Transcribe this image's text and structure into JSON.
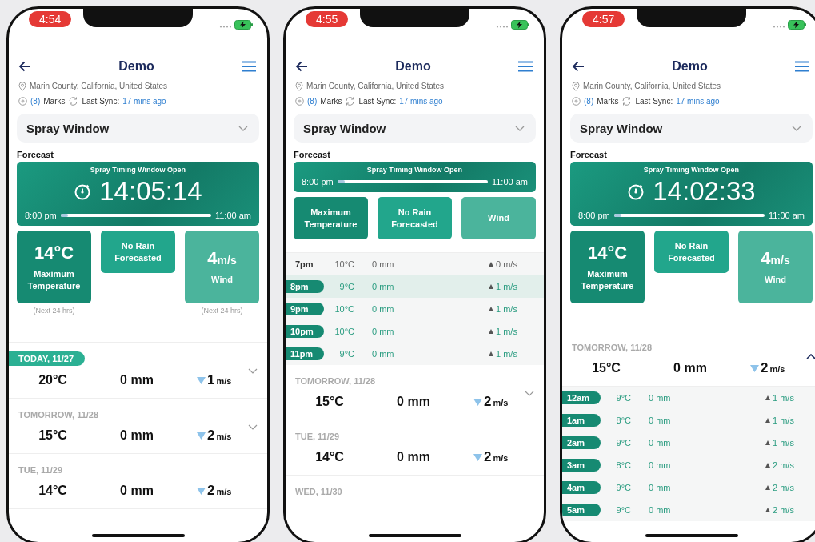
{
  "phones": [
    {
      "status_time": "4:54",
      "title": "Demo",
      "location": "Marin County, California, United States",
      "marks_count": "(8)",
      "marks_label": "Marks",
      "sync_label": "Last Sync:",
      "sync_value": "17 mins ago",
      "dropdown": "Spray Window",
      "section": "Forecast",
      "window": {
        "heading": "Spray Timing Window Open",
        "countdown": "14:05:14",
        "start": "8:00 pm",
        "end": "11:00 am",
        "level": 0.05
      },
      "tiles": [
        {
          "value": "14°C",
          "label": "Maximum Temperature",
          "note": "(Next 24 hrs)"
        },
        {
          "label": "No Rain Forecasted"
        },
        {
          "value": "4",
          "unit": "m/s",
          "label": "Wind",
          "note": "(Next 24 hrs)"
        }
      ],
      "list": [
        {
          "kind": "day",
          "date": "TODAY, 11/27",
          "selected": true,
          "expanded": false,
          "temp": "20°C",
          "rain": "0 mm",
          "wind": "1",
          "unit": "m/s"
        },
        {
          "kind": "day",
          "date": "TOMORROW, 11/28",
          "selected": false,
          "expanded": false,
          "temp": "15°C",
          "rain": "0 mm",
          "wind": "2",
          "unit": "m/s"
        },
        {
          "kind": "day",
          "date": "TUE, 11/29",
          "selected": false,
          "temp": "14°C",
          "rain": "0 mm",
          "wind": "2",
          "unit": "m/s"
        }
      ]
    },
    {
      "status_time": "4:55",
      "title": "Demo",
      "location": "Marin County, California, United States",
      "marks_count": "(8)",
      "marks_label": "Marks",
      "sync_label": "Last Sync:",
      "sync_value": "17 mins ago",
      "dropdown": "Spray Window",
      "section": "Forecast",
      "window": {
        "heading": "Spray Timing Window Open",
        "start": "8:00 pm",
        "end": "11:00 am",
        "level": 0.05
      },
      "tiles": [
        {
          "label": "Maximum Temperature"
        },
        {
          "label": "No Rain Forecasted"
        },
        {
          "label": "Wind"
        }
      ],
      "list": [
        {
          "kind": "hour",
          "time": "7pm",
          "badge": false,
          "highlighted": false,
          "temp": "10°C",
          "rain": "0 mm",
          "wind": "0 m/s"
        },
        {
          "kind": "hour",
          "time": "8pm",
          "badge": true,
          "highlighted": true,
          "temp": "9°C",
          "rain": "0 mm",
          "wind": "1 m/s"
        },
        {
          "kind": "hour",
          "time": "9pm",
          "badge": true,
          "highlighted": false,
          "temp": "10°C",
          "rain": "0 mm",
          "wind": "1 m/s"
        },
        {
          "kind": "hour",
          "time": "10pm",
          "badge": true,
          "highlighted": false,
          "temp": "10°C",
          "rain": "0 mm",
          "wind": "1 m/s"
        },
        {
          "kind": "hour",
          "time": "11pm",
          "badge": true,
          "highlighted": false,
          "temp": "9°C",
          "rain": "0 mm",
          "wind": "1 m/s"
        },
        {
          "kind": "day",
          "date": "TOMORROW, 11/28",
          "selected": false,
          "expanded": false,
          "temp": "15°C",
          "rain": "0 mm",
          "wind": "2",
          "unit": "m/s"
        },
        {
          "kind": "day",
          "date": "TUE, 11/29",
          "selected": false,
          "temp": "14°C",
          "rain": "0 mm",
          "wind": "2",
          "unit": "m/s"
        },
        {
          "kind": "day",
          "date": "WED, 11/30",
          "selected": false
        }
      ]
    },
    {
      "status_time": "4:57",
      "title": "Demo",
      "location": "Marin County, California, United States",
      "marks_count": "(8)",
      "marks_label": "Marks",
      "sync_label": "Last Sync:",
      "sync_value": "17 mins ago",
      "dropdown": "Spray Window",
      "section": "Forecast",
      "window": {
        "heading": "Spray Timing Window Open",
        "countdown": "14:02:33",
        "start": "8:00 pm",
        "end": "11:00 am",
        "level": 0.05
      },
      "tiles": [
        {
          "value": "14°C",
          "label": "Maximum Temperature"
        },
        {
          "label": "No Rain Forecasted"
        },
        {
          "value": "4",
          "unit": "m/s",
          "label": "Wind"
        }
      ],
      "list": [
        {
          "kind": "day",
          "date": "TOMORROW, 11/28",
          "selected": false,
          "expanded": true,
          "temp": "15°C",
          "rain": "0 mm",
          "wind": "2",
          "unit": "m/s"
        },
        {
          "kind": "hour",
          "time": "12am",
          "badge": true,
          "highlighted": false,
          "temp": "9°C",
          "rain": "0 mm",
          "wind": "1 m/s"
        },
        {
          "kind": "hour",
          "time": "1am",
          "badge": true,
          "highlighted": false,
          "temp": "8°C",
          "rain": "0 mm",
          "wind": "1 m/s"
        },
        {
          "kind": "hour",
          "time": "2am",
          "badge": true,
          "highlighted": false,
          "temp": "9°C",
          "rain": "0 mm",
          "wind": "1 m/s"
        },
        {
          "kind": "hour",
          "time": "3am",
          "badge": true,
          "highlighted": false,
          "temp": "8°C",
          "rain": "0 mm",
          "wind": "2 m/s"
        },
        {
          "kind": "hour",
          "time": "4am",
          "badge": true,
          "highlighted": false,
          "temp": "9°C",
          "rain": "0 mm",
          "wind": "2 m/s"
        },
        {
          "kind": "hour",
          "time": "5am",
          "badge": true,
          "highlighted": false,
          "temp": "9°C",
          "rain": "0 mm",
          "wind": "2 m/s"
        }
      ]
    }
  ]
}
